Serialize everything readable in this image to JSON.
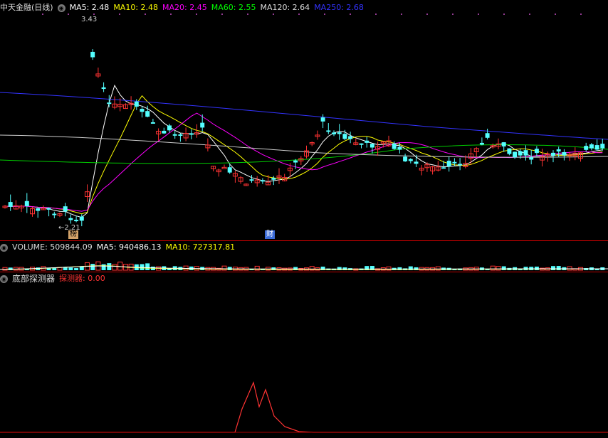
{
  "title": "中天金融(日线)",
  "ma_legend": [
    {
      "text": "MA5: 2.48",
      "color": "#ffffff"
    },
    {
      "text": "MA10: 2.48",
      "color": "#ffff00"
    },
    {
      "text": "MA20: 2.45",
      "color": "#ff00ff"
    },
    {
      "text": "MA60: 2.55",
      "color": "#00ff00"
    },
    {
      "text": "MA120: 2.64",
      "color": "#dddddd"
    },
    {
      "text": "MA250: 2.68",
      "color": "#3333ff"
    }
  ],
  "price_high": "3.43",
  "price_low": "2.21",
  "marker_bang": "榜",
  "marker_cai": "财",
  "volume_title": "VOLUME: 509844.09",
  "volume_ma5": "MA5: 940486.13",
  "volume_ma10": "MA10: 727317.81",
  "indicator_name": "底部探测器",
  "indicator_value": "探测器: 0.00",
  "colors": {
    "up": "#ff3333",
    "down": "#54ffff",
    "panel_border": "#aa0000"
  }
}
